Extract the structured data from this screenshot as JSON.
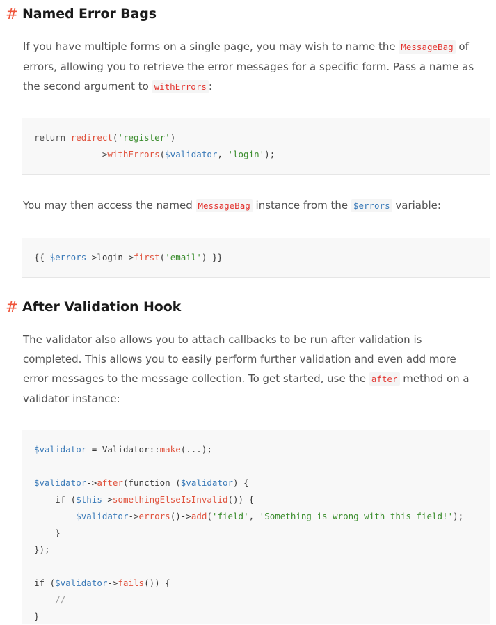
{
  "section1": {
    "hash": "#",
    "title": "Named Error Bags",
    "para1": {
      "t1": "If you have multiple forms on a single page, you may wish to name the ",
      "c1": "MessageBag",
      "t2": " of",
      "line2": "errors, allowing you to retrieve the error messages for a specific form. Pass a name as",
      "t3": "the second argument to ",
      "c2": "withErrors",
      "t4": ":"
    },
    "code1": {
      "l1": {
        "a": "return ",
        "b": "redirect",
        "c": "(",
        "d": "'register'",
        "e": ")"
      },
      "l2": {
        "a": "            ->",
        "b": "withErrors",
        "c": "(",
        "d": "$validator",
        "e": ", ",
        "f": "'login'",
        "g": ");"
      }
    },
    "para2": {
      "t1": "You may then access the named ",
      "c1": "MessageBag",
      "t2": " instance from the ",
      "c2": "$errors",
      "t3": " variable:"
    },
    "code2": {
      "a": "{{ ",
      "b": "$errors",
      "c": "->",
      "d": "login",
      "e": "->",
      "f": "first",
      "g": "(",
      "h": "'email'",
      "i": ") }}"
    }
  },
  "section2": {
    "hash": "#",
    "title": "After Validation Hook",
    "para": {
      "line1": "The validator also allows you to attach callbacks to be run after validation is",
      "line2": "completed. This allows you to easily perform further validation and even add more",
      "t1": "error messages to the message collection. To get started, use the ",
      "c1": "after",
      "t2": " method on a",
      "line4": "validator instance:"
    },
    "code": {
      "l1": {
        "a": "$validator",
        "b": " = Validator::",
        "c": "make",
        "d": "(...);"
      },
      "l3": {
        "a": "$validator",
        "b": "->",
        "c": "after",
        "d": "(function (",
        "e": "$validator",
        "f": ") {"
      },
      "l4": {
        "a": "    if (",
        "b": "$this",
        "c": "->",
        "d": "somethingElseIsInvalid",
        "e": "()) {"
      },
      "l5": {
        "a": "        ",
        "b": "$validator",
        "c": "->",
        "d": "errors",
        "e": "()->",
        "f": "add",
        "g": "(",
        "h": "'field'",
        "i": ", ",
        "j": "'Something is wrong with this field!'",
        "k": ");"
      },
      "l6": "    }",
      "l7": "});",
      "l9": {
        "a": "if (",
        "b": "$validator",
        "c": "->",
        "d": "fails",
        "e": "()) {"
      },
      "l10": "    //",
      "l11": "}"
    }
  }
}
